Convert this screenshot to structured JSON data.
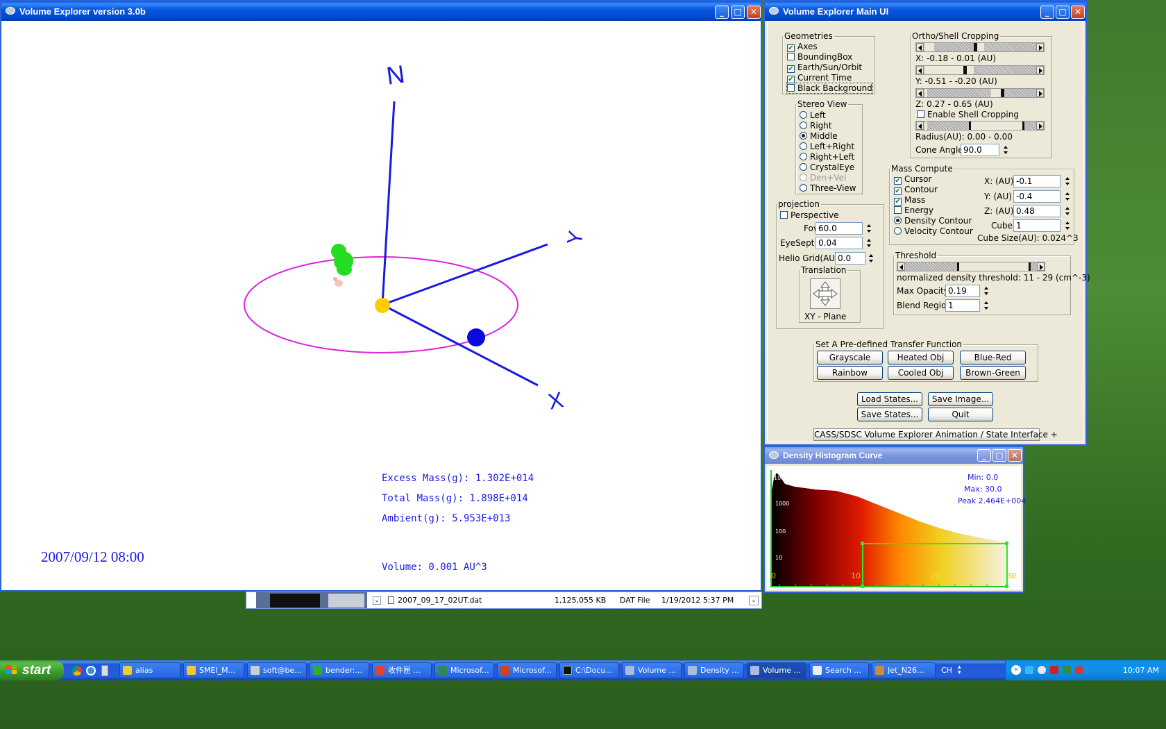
{
  "viewer": {
    "title": "Volume Explorer version 3.0b",
    "axis_labels": {
      "n": "N",
      "y": "Y",
      "x": "X"
    },
    "excess_mass": "Excess Mass(g): 1.302E+014",
    "total_mass": "Total Mass(g): 1.898E+014",
    "ambient": "Ambient(g): 5.953E+013",
    "volume": "Volume: 0.001 AU^3",
    "datetime": "2007/09/12 08:00",
    "colors": {
      "axis": "#1a1adf",
      "orbit": "#e020e0",
      "sun": "#ffcc00",
      "earth": "#0a0adf",
      "cloud": "#22dd22"
    }
  },
  "mainui": {
    "title": "Volume Explorer Main UI",
    "geometries": {
      "legend": "Geometries",
      "items": [
        {
          "label": "Axes",
          "checked": true
        },
        {
          "label": "BoundingBox",
          "checked": false
        },
        {
          "label": "Earth/Sun/Orbit",
          "checked": true
        },
        {
          "label": "Current Time",
          "checked": true
        },
        {
          "label": "Black Background",
          "checked": false
        }
      ]
    },
    "stereo": {
      "legend": "Stereo View",
      "options": [
        {
          "label": "Left",
          "selected": false,
          "disabled": false
        },
        {
          "label": "Right",
          "selected": false,
          "disabled": false
        },
        {
          "label": "Middle",
          "selected": true,
          "disabled": false
        },
        {
          "label": "Left+Right",
          "selected": false,
          "disabled": false
        },
        {
          "label": "Right+Left",
          "selected": false,
          "disabled": false
        },
        {
          "label": "CrystalEye",
          "selected": false,
          "disabled": false
        },
        {
          "label": "Den+Vel",
          "selected": false,
          "disabled": true
        },
        {
          "label": "Three-View",
          "selected": false,
          "disabled": false
        }
      ]
    },
    "cropping": {
      "legend": "Ortho/Shell Cropping",
      "x_label": "X: -0.18 - 0.01 (AU)",
      "y_label": "Y: -0.51 - -0.20 (AU)",
      "z_label": "Z: 0.27 - 0.65 (AU)",
      "shell_label": "Enable Shell Cropping",
      "shell_checked": false,
      "radius_label": "Radius(AU): 0.00 - 0.00",
      "cone_label": "Cone Angle",
      "cone_value": "90.0"
    },
    "projection": {
      "legend": "projection",
      "perspective_label": "Perspective",
      "perspective_checked": false,
      "fov_label": "Fov",
      "fov_value": "60.0",
      "eyesept_label": "EyeSept",
      "eyesept_value": "0.04",
      "helio_label": "Helio Grid(AU)",
      "helio_value": "0.0",
      "translation_legend": "Translation",
      "plane_label": "XY - Plane"
    },
    "mass": {
      "legend": "Mass Compute",
      "checks": [
        {
          "label": "Cursor",
          "checked": true
        },
        {
          "label": "Contour",
          "checked": true
        },
        {
          "label": "Mass",
          "checked": true
        },
        {
          "label": "Energy",
          "checked": false
        }
      ],
      "radios": [
        {
          "label": "Density Contour",
          "selected": true
        },
        {
          "label": "Velocity Contour",
          "selected": false
        }
      ],
      "x_label": "X: (AU)",
      "x_value": "-0.1",
      "y_label": "Y: (AU)",
      "y_value": "-0.4",
      "z_label": "Z: (AU)",
      "z_value": "0.48",
      "cube_label": "Cube",
      "cube_value": "1",
      "cube_size": "Cube Size(AU): 0.024^3"
    },
    "threshold": {
      "legend": "Threshold",
      "density_text": "normalized density threshold: 11 - 29 (cm^-3)",
      "opacity_label": "Max Opacity",
      "opacity_value": "0.19",
      "blend_label": "Blend Region",
      "blend_value": "1"
    },
    "transfer": {
      "legend": "Set A Pre-defined Transfer Function",
      "buttons": [
        "Grayscale",
        "Heated Obj",
        "Blue-Red",
        "Rainbow",
        "Cooled Obj",
        "Brown-Green"
      ]
    },
    "actions": {
      "load": "Load States...",
      "save_image": "Save Image...",
      "save": "Save States...",
      "quit": "Quit"
    },
    "footer": "CASS/SDSC Volume Explorer Animation / State Interface"
  },
  "histogram": {
    "title": "Density Histogram Curve",
    "min": "Min: 0.0",
    "max": "Max: 30.0",
    "peak": "Peak 2.464E+004",
    "y_ticks": [
      "10000",
      "1000",
      "100",
      "10"
    ],
    "x_ticks": [
      "0",
      "10",
      "20",
      "30"
    ],
    "range": [
      11,
      29
    ]
  },
  "explorer_strip": {
    "file_name": "2007_09_17_02UT.dat",
    "size": "1,125,055 KB",
    "type": "DAT File",
    "date": "1/19/2012 5:37 PM"
  },
  "taskbar": {
    "start": "start",
    "items": [
      {
        "label": "alias",
        "color": "#f5c542"
      },
      {
        "label": "SMEI_M...",
        "color": "#f5c542"
      },
      {
        "label": "soft@be...",
        "color": "#cccccc"
      },
      {
        "label": "bender:...",
        "color": "#33aa33"
      },
      {
        "label": "收件匣 ...",
        "color": "#dd4433"
      },
      {
        "label": "Microsof...",
        "color": "#2e8b57"
      },
      {
        "label": "Microsof...",
        "color": "#cc4422"
      },
      {
        "label": "C:\\Docu...",
        "color": "#111111"
      },
      {
        "label": "Volume ...",
        "color": "#aabbdd"
      },
      {
        "label": "Density ...",
        "color": "#aabbdd"
      },
      {
        "label": "Volume ...",
        "color": "#aabbdd"
      },
      {
        "label": "Search ...",
        "color": "#eeeeee"
      },
      {
        "label": "Jet_N26...",
        "color": "#cc8844"
      }
    ],
    "lang": "CH",
    "clock": "10:07 AM"
  }
}
